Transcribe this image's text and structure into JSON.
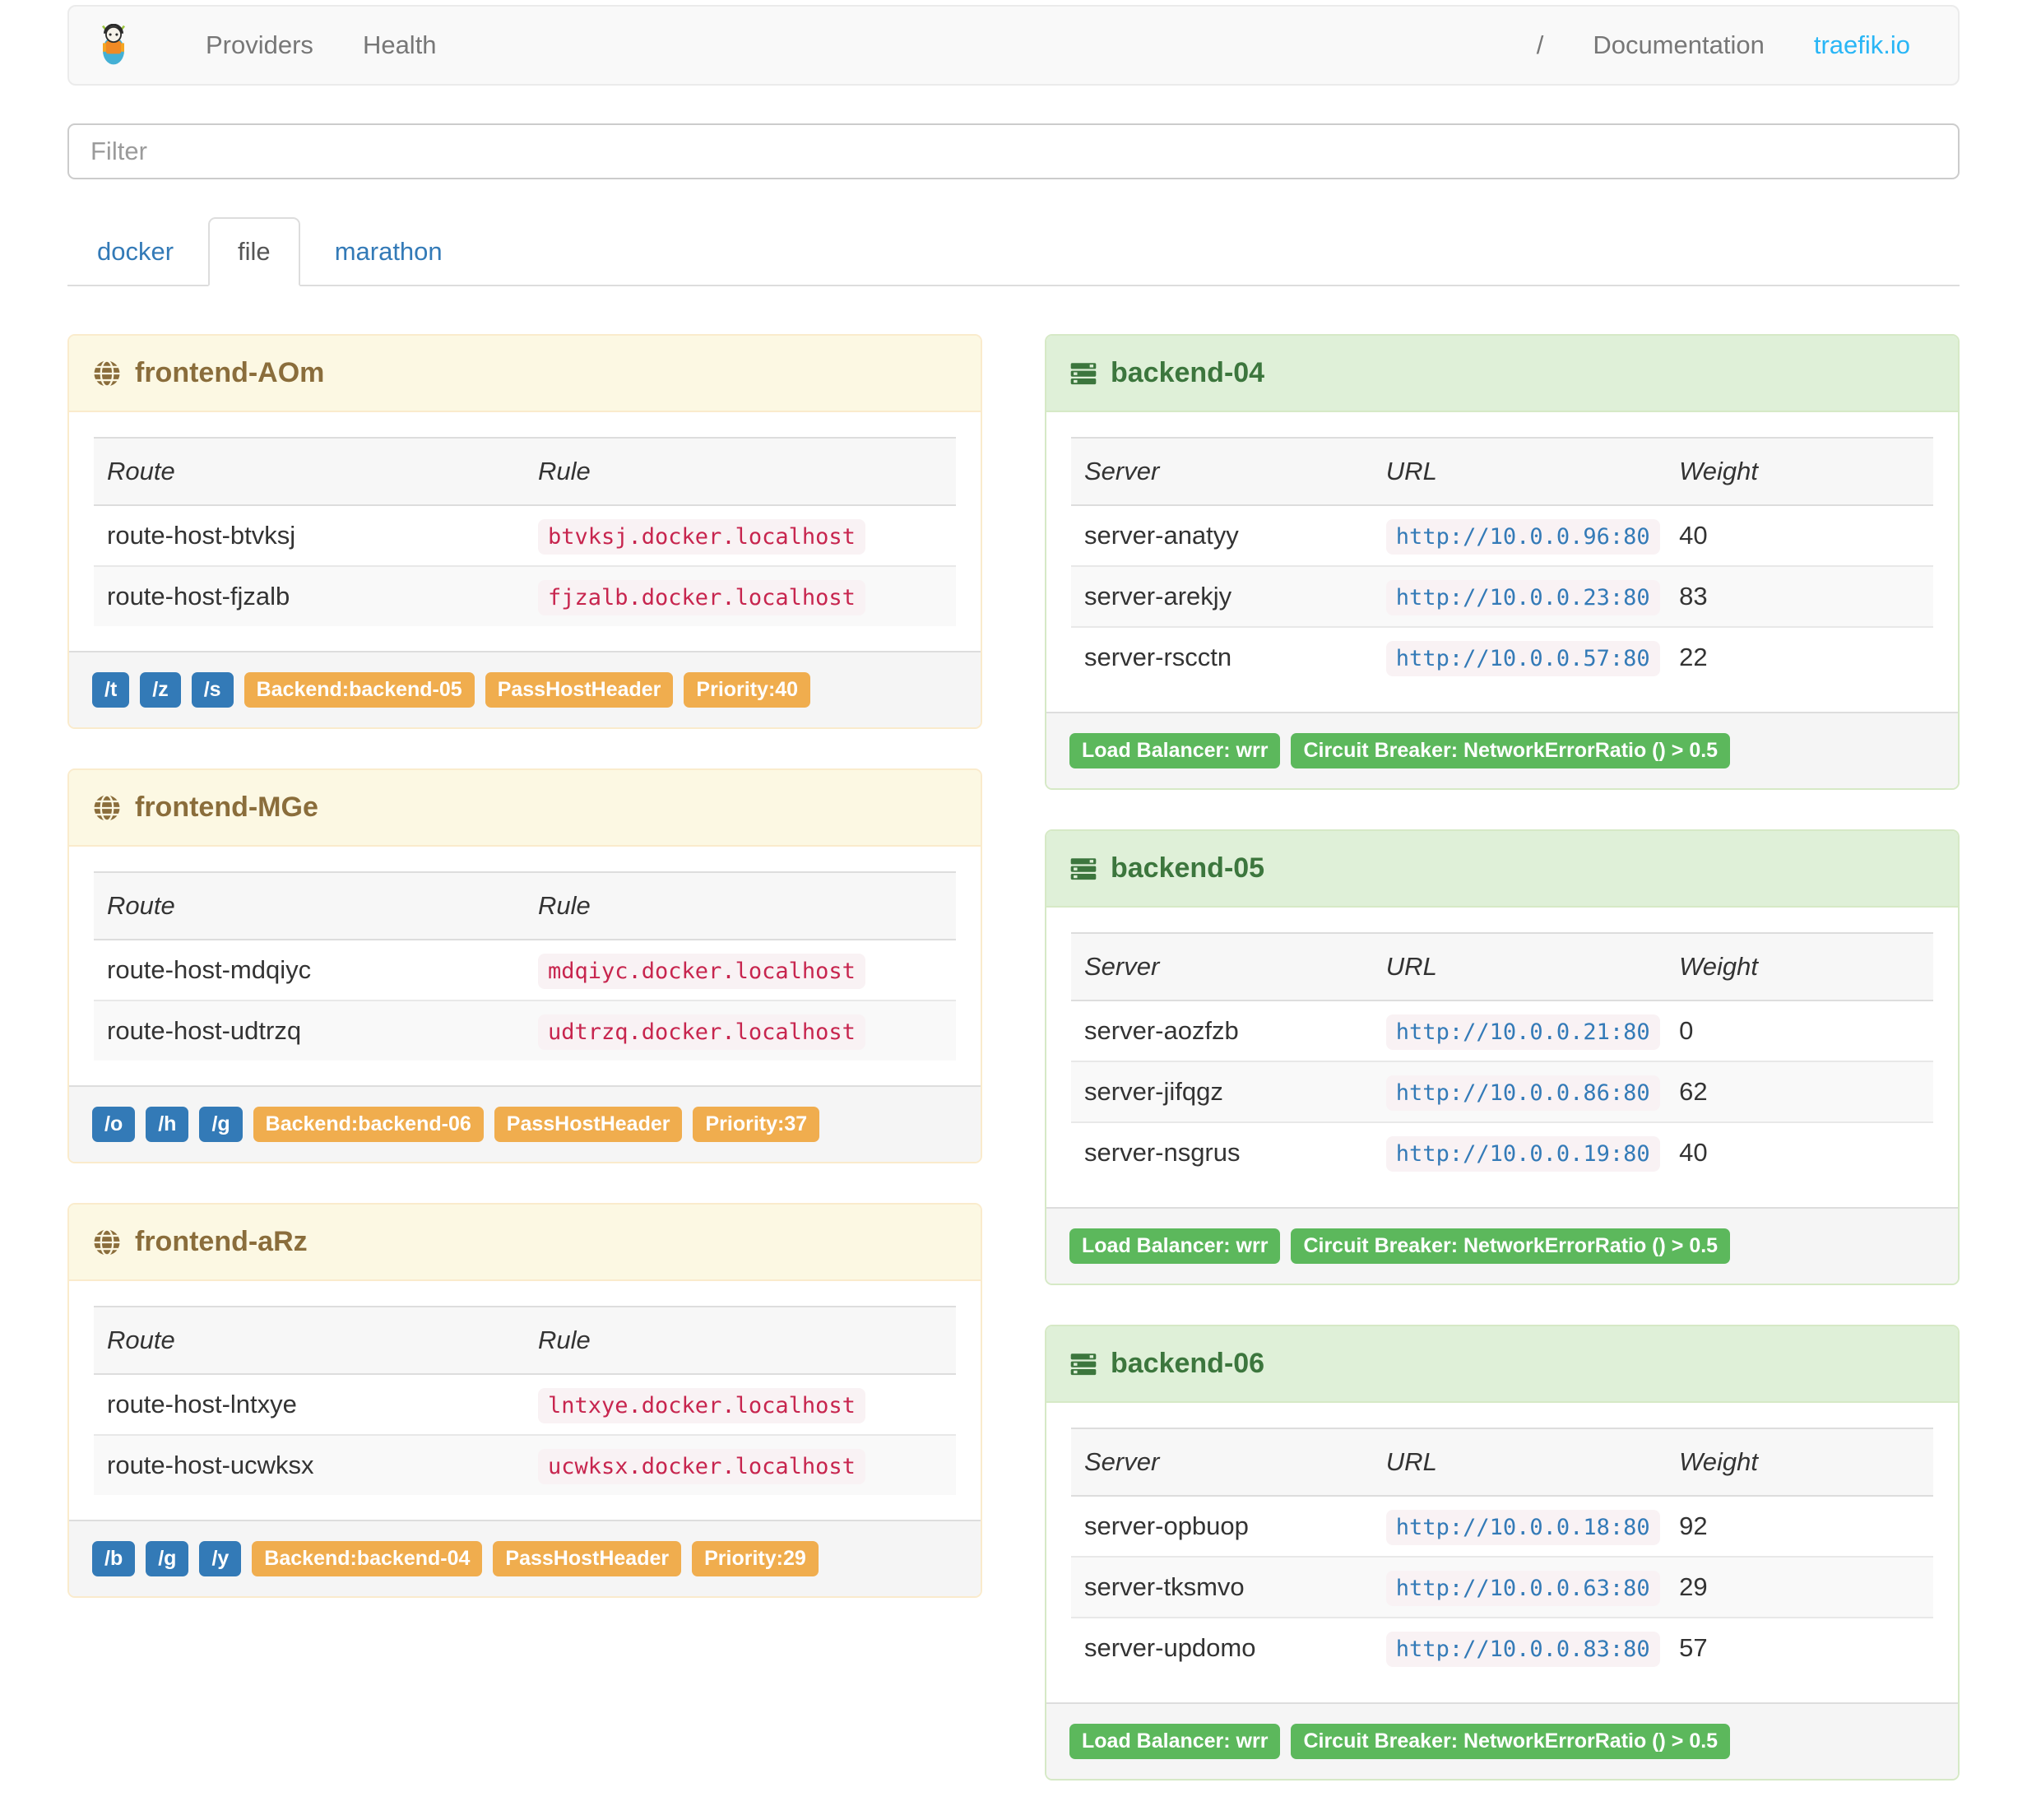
{
  "navbar": {
    "brand_icon": "traefik-logo",
    "links": [
      "Providers",
      "Health"
    ],
    "right_links": [
      "/",
      "Documentation",
      "traefik.io"
    ]
  },
  "filter": {
    "placeholder": "Filter"
  },
  "tabs": [
    {
      "label": "docker",
      "active": false
    },
    {
      "label": "file",
      "active": true
    },
    {
      "label": "marathon",
      "active": false
    }
  ],
  "frontends": {
    "icon": "globe-icon",
    "columns": [
      "Route",
      "Rule"
    ],
    "panels": [
      {
        "title": "frontend-AOm",
        "routes": [
          {
            "route": "route-host-btvksj",
            "rule": "btvksj.docker.localhost"
          },
          {
            "route": "route-host-fjzalb",
            "rule": "fjzalb.docker.localhost"
          }
        ],
        "path_badges": [
          "/t",
          "/z",
          "/s"
        ],
        "badges": [
          "Backend:backend-05",
          "PassHostHeader",
          "Priority:40"
        ]
      },
      {
        "title": "frontend-MGe",
        "routes": [
          {
            "route": "route-host-mdqiyc",
            "rule": "mdqiyc.docker.localhost"
          },
          {
            "route": "route-host-udtrzq",
            "rule": "udtrzq.docker.localhost"
          }
        ],
        "path_badges": [
          "/o",
          "/h",
          "/g"
        ],
        "badges": [
          "Backend:backend-06",
          "PassHostHeader",
          "Priority:37"
        ]
      },
      {
        "title": "frontend-aRz",
        "routes": [
          {
            "route": "route-host-lntxye",
            "rule": "lntxye.docker.localhost"
          },
          {
            "route": "route-host-ucwksx",
            "rule": "ucwksx.docker.localhost"
          }
        ],
        "path_badges": [
          "/b",
          "/g",
          "/y"
        ],
        "badges": [
          "Backend:backend-04",
          "PassHostHeader",
          "Priority:29"
        ]
      }
    ]
  },
  "backends": {
    "icon": "servers-icon",
    "columns": [
      "Server",
      "URL",
      "Weight"
    ],
    "panels": [
      {
        "title": "backend-04",
        "servers": [
          {
            "server": "server-anatyy",
            "url": "http://10.0.0.96:80",
            "weight": "40"
          },
          {
            "server": "server-arekjy",
            "url": "http://10.0.0.23:80",
            "weight": "83"
          },
          {
            "server": "server-rscctn",
            "url": "http://10.0.0.57:80",
            "weight": "22"
          }
        ],
        "badges": [
          "Load Balancer: wrr",
          "Circuit Breaker: NetworkErrorRatio () > 0.5"
        ]
      },
      {
        "title": "backend-05",
        "servers": [
          {
            "server": "server-aozfzb",
            "url": "http://10.0.0.21:80",
            "weight": "0"
          },
          {
            "server": "server-jifqgz",
            "url": "http://10.0.0.86:80",
            "weight": "62"
          },
          {
            "server": "server-nsgrus",
            "url": "http://10.0.0.19:80",
            "weight": "40"
          }
        ],
        "badges": [
          "Load Balancer: wrr",
          "Circuit Breaker: NetworkErrorRatio () > 0.5"
        ]
      },
      {
        "title": "backend-06",
        "servers": [
          {
            "server": "server-opbuop",
            "url": "http://10.0.0.18:80",
            "weight": "92"
          },
          {
            "server": "server-tksmvo",
            "url": "http://10.0.0.63:80",
            "weight": "29"
          },
          {
            "server": "server-updomo",
            "url": "http://10.0.0.83:80",
            "weight": "57"
          }
        ],
        "badges": [
          "Load Balancer: wrr",
          "Circuit Breaker: NetworkErrorRatio () > 0.5"
        ]
      }
    ]
  },
  "colors": {
    "accent_blue": "#337ab7",
    "warning_orange": "#f0ad4e",
    "success_green": "#5cb85c",
    "frontend_header_bg": "#fcf8e3",
    "frontend_header_text": "#8a6d3b",
    "frontend_border": "#faebcc",
    "backend_header_bg": "#dff0d8",
    "backend_header_text": "#3c763d",
    "backend_border": "#d6e9c6",
    "code_pink": "#c7254e",
    "code_bg": "#f9f2f4",
    "link_cyan": "#29b6f6"
  }
}
